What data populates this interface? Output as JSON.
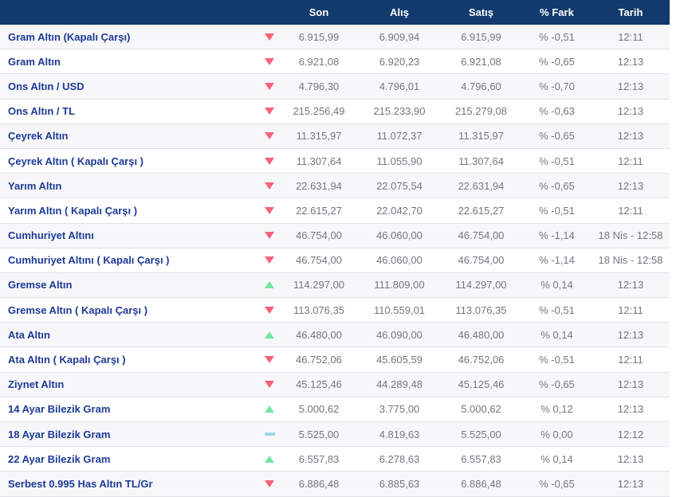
{
  "colors": {
    "header_bg": "#123a6d",
    "label_blue": "#1d3a96",
    "number_gray": "#75757e",
    "stripe": "#f7f7f9",
    "down_arrow": "#f8617b",
    "up_arrow": "#74e5a2",
    "flat_dash": "#99d8e6"
  },
  "header": {
    "name": "",
    "direction": "",
    "son": "Son",
    "alis": "Alış",
    "satis": "Satış",
    "fark": "% Fark",
    "tarih": "Tarih"
  },
  "rows": [
    {
      "name": "Gram Altın (Kapalı Çarşı)",
      "direction": "down",
      "son": "6.915,99",
      "alis": "6.909,94",
      "satis": "6.915,99",
      "fark": "% -0,51",
      "tarih": "12:11"
    },
    {
      "name": "Gram Altın",
      "direction": "down",
      "son": "6.921,08",
      "alis": "6.920,23",
      "satis": "6.921,08",
      "fark": "% -0,65",
      "tarih": "12:13"
    },
    {
      "name": "Ons Altın / USD",
      "direction": "down",
      "son": "4.796,30",
      "alis": "4.796,01",
      "satis": "4.796,60",
      "fark": "% -0,70",
      "tarih": "12:13"
    },
    {
      "name": "Ons Altın / TL",
      "direction": "down",
      "son": "215.256,49",
      "alis": "215.233,90",
      "satis": "215.279,08",
      "fark": "% -0,63",
      "tarih": "12:13"
    },
    {
      "name": "Çeyrek Altın",
      "direction": "down",
      "son": "11.315,97",
      "alis": "11.072,37",
      "satis": "11.315,97",
      "fark": "% -0,65",
      "tarih": "12:13"
    },
    {
      "name": "Çeyrek Altın ( Kapalı Çarşı )",
      "direction": "down",
      "son": "11.307,64",
      "alis": "11.055,90",
      "satis": "11.307,64",
      "fark": "% -0,51",
      "tarih": "12:11"
    },
    {
      "name": "Yarım Altın",
      "direction": "down",
      "son": "22.631,94",
      "alis": "22.075,54",
      "satis": "22.631,94",
      "fark": "% -0,65",
      "tarih": "12:13"
    },
    {
      "name": "Yarım Altın ( Kapalı Çarşı )",
      "direction": "down",
      "son": "22.615,27",
      "alis": "22.042,70",
      "satis": "22.615,27",
      "fark": "% -0,51",
      "tarih": "12:11"
    },
    {
      "name": "Cumhuriyet Altını",
      "direction": "down",
      "son": "46.754,00",
      "alis": "46.060,00",
      "satis": "46.754,00",
      "fark": "% -1,14",
      "tarih": "18 Nis - 12:58"
    },
    {
      "name": "Cumhuriyet Altını ( Kapalı Çarşı )",
      "direction": "down",
      "son": "46.754,00",
      "alis": "46.060,00",
      "satis": "46.754,00",
      "fark": "% -1,14",
      "tarih": "18 Nis - 12:58"
    },
    {
      "name": "Gremse Altın",
      "direction": "up",
      "son": "114.297,00",
      "alis": "111.809,00",
      "satis": "114.297,00",
      "fark": "% 0,14",
      "tarih": "12:13"
    },
    {
      "name": "Gremse Altın ( Kapalı Çarşı )",
      "direction": "down",
      "son": "113.076,35",
      "alis": "110.559,01",
      "satis": "113.076,35",
      "fark": "% -0,51",
      "tarih": "12:11"
    },
    {
      "name": "Ata Altın",
      "direction": "up",
      "son": "46.480,00",
      "alis": "46.090,00",
      "satis": "46.480,00",
      "fark": "% 0,14",
      "tarih": "12:13"
    },
    {
      "name": "Ata Altın ( Kapalı Çarşı )",
      "direction": "down",
      "son": "46.752,06",
      "alis": "45.605,59",
      "satis": "46.752,06",
      "fark": "% -0,51",
      "tarih": "12:11"
    },
    {
      "name": "Ziynet Altın",
      "direction": "down",
      "son": "45.125,46",
      "alis": "44.289,48",
      "satis": "45.125,46",
      "fark": "% -0,65",
      "tarih": "12:13"
    },
    {
      "name": "14 Ayar Bilezik Gram",
      "direction": "up",
      "son": "5.000,62",
      "alis": "3.775,00",
      "satis": "5.000,62",
      "fark": "% 0,12",
      "tarih": "12:13"
    },
    {
      "name": "18 Ayar Bilezik Gram",
      "direction": "flat",
      "son": "5.525,00",
      "alis": "4.819,63",
      "satis": "5.525,00",
      "fark": "% 0,00",
      "tarih": "12:12"
    },
    {
      "name": "22 Ayar Bilezik Gram",
      "direction": "up",
      "son": "6.557,83",
      "alis": "6.278,63",
      "satis": "6.557,83",
      "fark": "% 0,14",
      "tarih": "12:13"
    },
    {
      "name": "Serbest 0.995 Has Altın TL/Gr",
      "direction": "down",
      "son": "6.886,48",
      "alis": "6.885,63",
      "satis": "6.886,48",
      "fark": "% -0,65",
      "tarih": "12:13"
    }
  ]
}
